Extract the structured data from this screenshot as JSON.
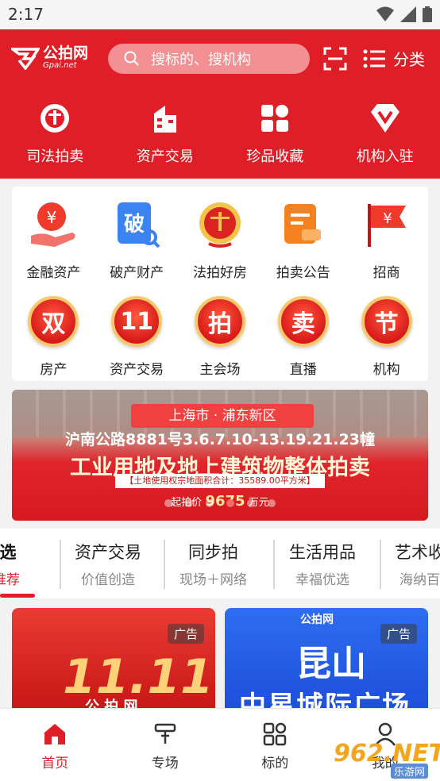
{
  "status": {
    "time": "2:17"
  },
  "header": {
    "logo_cn": "公拍网",
    "logo_en": "Gpai.net",
    "search_placeholder": "搜标的、搜机构",
    "category_label": "分类",
    "nav": [
      {
        "label": "司法拍卖",
        "icon": "court-emblem-icon"
      },
      {
        "label": "资产交易",
        "icon": "building-icon"
      },
      {
        "label": "珍品收藏",
        "icon": "collection-grid-icon"
      },
      {
        "label": "机构入驻",
        "icon": "diamond-v-icon"
      }
    ]
  },
  "grid": {
    "row1": [
      {
        "label": "金融资产",
        "icon": "finance-yen-hand-icon"
      },
      {
        "label": "破产财产",
        "icon": "bankruptcy-icon"
      },
      {
        "label": "法拍好房",
        "icon": "court-emblem-icon"
      },
      {
        "label": "拍卖公告",
        "icon": "notice-doc-icon"
      },
      {
        "label": "招商",
        "icon": "flag-yen-icon"
      }
    ],
    "row2": [
      {
        "label": "房产",
        "badge": "双"
      },
      {
        "label": "资产交易",
        "badge": "11"
      },
      {
        "label": "主会场",
        "badge": "拍"
      },
      {
        "label": "直播",
        "badge": "卖"
      },
      {
        "label": "机构",
        "badge": "节"
      }
    ]
  },
  "banner": {
    "location": "上海市 · 浦东新区",
    "road": "沪南公路8881号3.6.7.10-13.19.21.23幢",
    "title": "工业用地及地上建筑物整体拍卖",
    "area_note": "【土地使用权宗地面积合计：35589.00平方米】",
    "price_label": "起拍价",
    "price_value": "9675",
    "price_unit": "万元",
    "dots": 6,
    "active_dot": 3
  },
  "tabs": [
    {
      "title": "精选",
      "subtitle": "您推荐",
      "active": true
    },
    {
      "title": "资产交易",
      "subtitle": "价值创造"
    },
    {
      "title": "同步拍",
      "subtitle": "现场＋网络"
    },
    {
      "title": "生活用品",
      "subtitle": "幸福优选"
    },
    {
      "title": "艺术收",
      "subtitle": "海纳百"
    }
  ],
  "feed": {
    "ad_label": "广告",
    "card1_big": "11.11",
    "card1_sub": "公 拍 网",
    "card2_logo": "公拍网",
    "card2_city": "昆山",
    "card2_mall": "中星城际广场"
  },
  "bottom_nav": [
    {
      "label": "首页",
      "icon": "home-icon",
      "active": true
    },
    {
      "label": "专场",
      "icon": "gavel-icon"
    },
    {
      "label": "标的",
      "icon": "grid-apps-icon"
    },
    {
      "label": "我的",
      "icon": "user-icon"
    }
  ],
  "watermark": {
    "brand": "962.NET",
    "sub": "乐游网"
  },
  "colors": {
    "brand_red": "#e01e27",
    "search_bg": "#f29094"
  }
}
